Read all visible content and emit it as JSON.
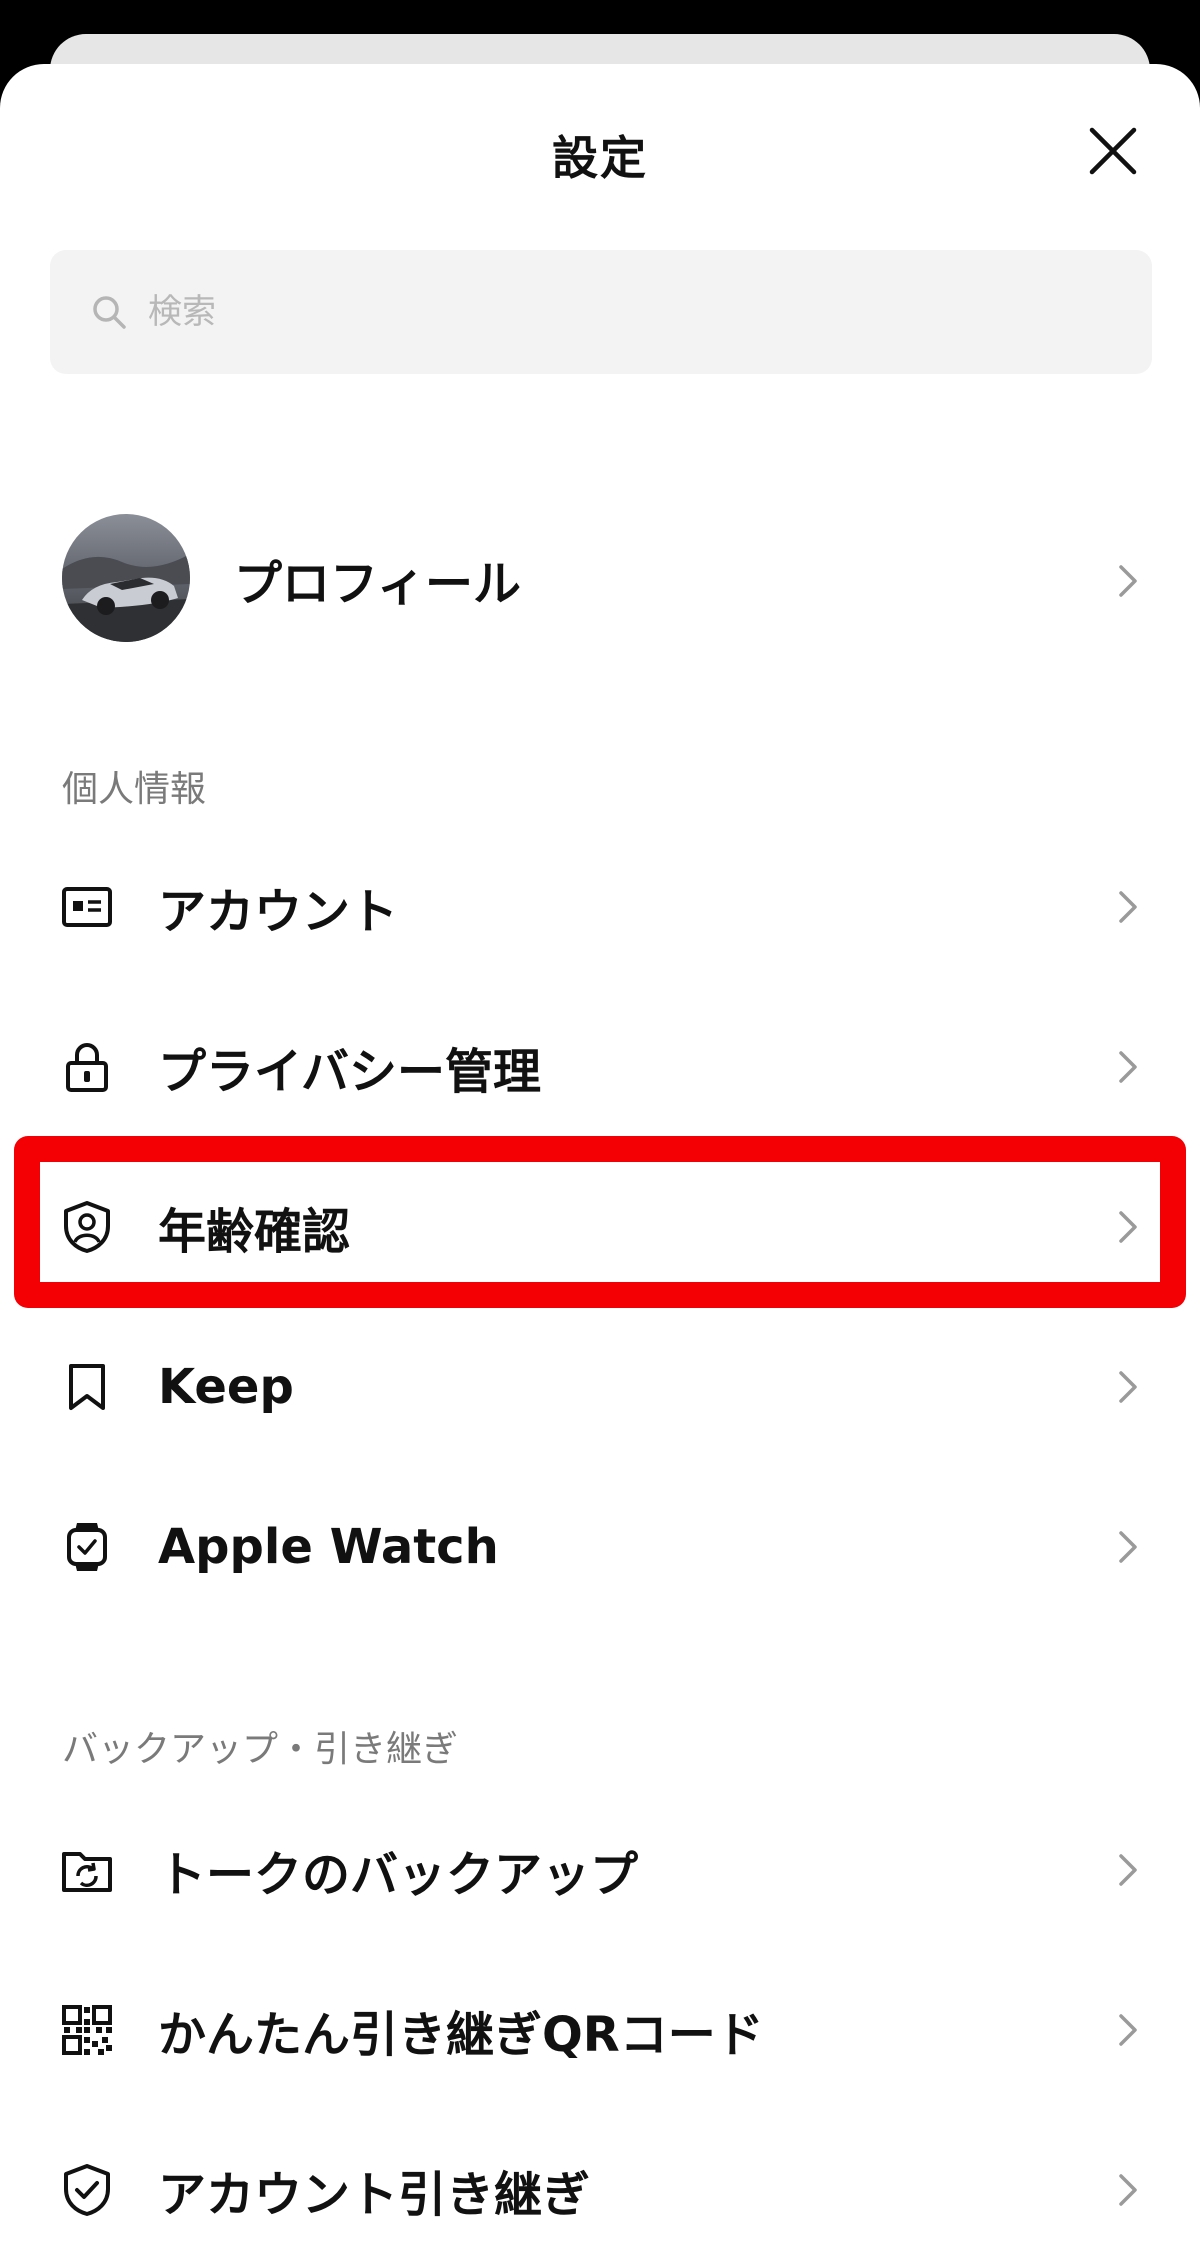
{
  "header": {
    "title": "設定"
  },
  "search": {
    "placeholder": "検索"
  },
  "profile": {
    "label": "プロフィール"
  },
  "sections": {
    "personal": "個人情報",
    "backup": "バックアップ・引き継ぎ"
  },
  "rows": {
    "account": "アカウント",
    "privacy": "プライバシー管理",
    "age_verification": "年齢確認",
    "keep": "Keep",
    "apple_watch": "Apple Watch",
    "talk_backup": "トークのバックアップ",
    "qr_transfer": "かんたん引き継ぎQRコード",
    "account_transfer": "アカウント引き継ぎ"
  },
  "colors": {
    "highlight": "#f40004",
    "section_text": "#7a7a7a",
    "chevron": "#9a9a9a"
  },
  "icons": {
    "close": "close-icon",
    "search": "search-icon",
    "account": "id-card-icon",
    "privacy": "lock-icon",
    "age": "shield-person-icon",
    "keep": "bookmark-icon",
    "watch": "watch-icon",
    "backup": "folder-sync-icon",
    "qr": "qr-code-icon",
    "transfer": "shield-check-icon",
    "chevron": "chevron-right-icon"
  }
}
